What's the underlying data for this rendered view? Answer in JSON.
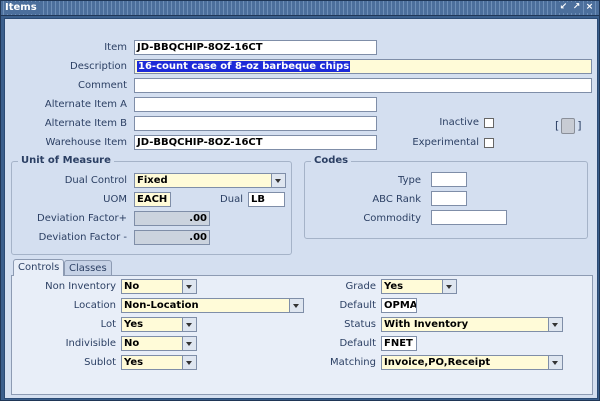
{
  "window": {
    "title": "Items",
    "buttons": [
      "minimize-icon",
      "maximize-icon",
      "close-icon"
    ]
  },
  "header": {
    "item": {
      "label": "Item",
      "value": "JD-BBQCHIP-8OZ-16CT"
    },
    "description": {
      "label": "Description",
      "value": "16-count case of 8-oz barbeque chips"
    },
    "comment": {
      "label": "Comment",
      "value": ""
    },
    "alternate_a": {
      "label": "Alternate Item A",
      "value": ""
    },
    "alternate_b": {
      "label": "Alternate Item B",
      "value": ""
    },
    "warehouse_item": {
      "label": "Warehouse Item",
      "value": "JD-BBQCHIP-8OZ-16CT"
    },
    "inactive": {
      "label": "Inactive",
      "checked": false
    },
    "experimental": {
      "label": "Experimental",
      "checked": false
    },
    "flex_open": "[",
    "flex_close": "]"
  },
  "unit_of_measure": {
    "title": "Unit of Measure",
    "dual_control": {
      "label": "Dual Control",
      "value": "Fixed"
    },
    "uom": {
      "label": "UOM",
      "value": "EACH"
    },
    "dual": {
      "label": "Dual",
      "value": "LB"
    },
    "deviation_plus": {
      "label": "Deviation Factor+",
      "value": ".00"
    },
    "deviation_minus": {
      "label": "Deviation Factor -",
      "value": ".00"
    }
  },
  "codes": {
    "title": "Codes",
    "type": {
      "label": "Type",
      "value": ""
    },
    "abc_rank": {
      "label": "ABC Rank",
      "value": ""
    },
    "commodity": {
      "label": "Commodity",
      "value": ""
    }
  },
  "tabs": [
    {
      "label": "Controls",
      "active": true
    },
    {
      "label": "Classes",
      "active": false
    }
  ],
  "controls": {
    "non_inventory": {
      "label": "Non Inventory",
      "value": "No"
    },
    "location": {
      "label": "Location",
      "value": "Non-Location"
    },
    "lot": {
      "label": "Lot",
      "value": "Yes"
    },
    "indivisible": {
      "label": "Indivisible",
      "value": "No"
    },
    "sublot": {
      "label": "Sublot",
      "value": "Yes"
    },
    "grade": {
      "label": "Grade",
      "value": "Yes"
    },
    "grade_default": {
      "label": "Default",
      "value": "OPMA"
    },
    "status": {
      "label": "Status",
      "value": "With Inventory"
    },
    "status_default": {
      "label": "Default",
      "value": "FNET"
    },
    "matching": {
      "label": "Matching",
      "value": "Invoice,PO,Receipt"
    }
  },
  "colors": {
    "window_bg": "#3b5f8c",
    "form_bg": "#d4dff0",
    "required_bg": "#fffbd8",
    "selection": "#1e2bd8"
  }
}
